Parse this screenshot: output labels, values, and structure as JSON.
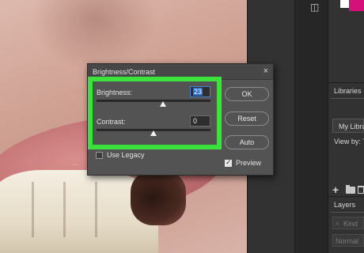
{
  "dialog": {
    "title": "Brightness/Contrast",
    "close_glyph": "×",
    "brightness_label": "Brightness:",
    "brightness_value": "23",
    "contrast_label": "Contrast:",
    "contrast_value": "0",
    "buttons": {
      "ok": "OK",
      "reset": "Reset",
      "auto": "Auto"
    },
    "use_legacy": {
      "label": "Use Legacy",
      "checked": false
    },
    "preview": {
      "label": "Preview",
      "checked": true
    }
  },
  "right_panel": {
    "libraries_tab": "Libraries",
    "library_name": "My Libra",
    "view_by": "View by: Typ",
    "layers_tab": "Layers",
    "layer_filter": "Kind",
    "blend_mode": "Normal"
  },
  "colors": {
    "highlight": "#3de13d",
    "foreground_swatch": "#d6107a",
    "background_swatch": "#ffffff"
  },
  "icons": [
    "close-icon",
    "plus-icon",
    "folder-icon",
    "trash-icon",
    "search-icon",
    "side-panel-icon"
  ]
}
